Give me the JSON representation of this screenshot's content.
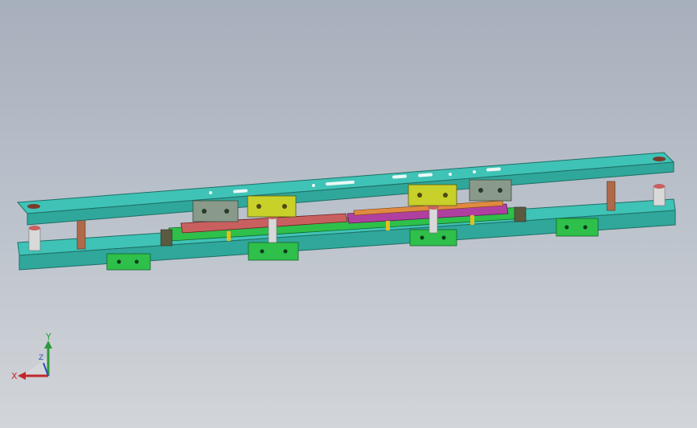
{
  "viewport": {
    "background_top": "#a6afbb",
    "background_bottom": "#d2d5d9"
  },
  "model": {
    "plate_color": "#3fc3b6",
    "plate_edge_color": "#1f6f66",
    "block_green": "#2ec04a",
    "block_yellow": "#c8d02a",
    "block_gray": "#8a9a8a",
    "strip_red": "#c96060",
    "strip_magenta": "#b040a0",
    "pillar_color": "#b06a4a",
    "bushing_color": "#d9d9d9"
  },
  "triad": {
    "x_label": "X",
    "y_label": "Y",
    "z_label": "Z",
    "x_color": "#c0282c",
    "y_color": "#2c9a3a",
    "z_color": "#2a4fb5"
  }
}
